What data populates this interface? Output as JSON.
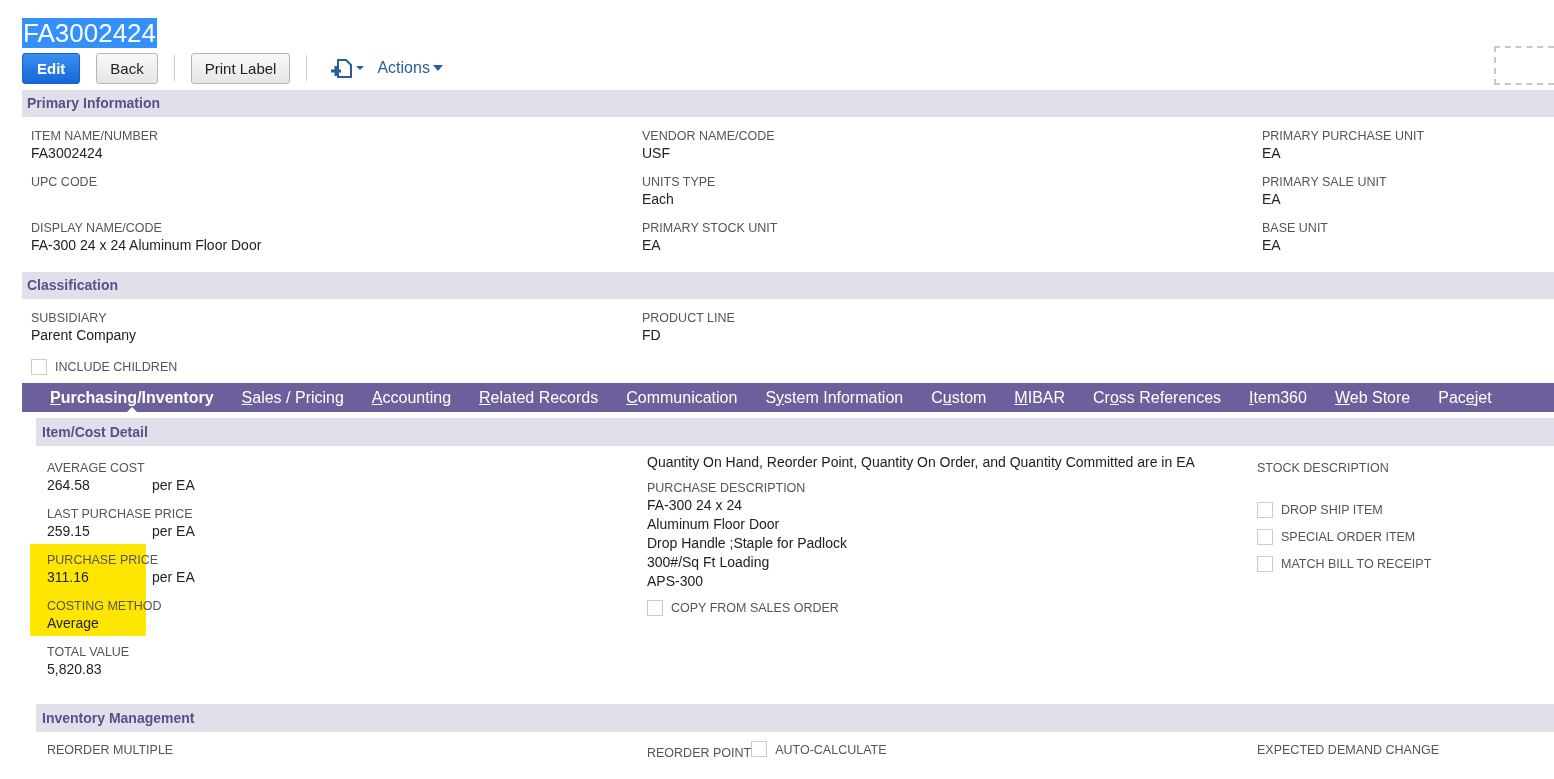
{
  "record": {
    "title": "FA3002424",
    "selected": true
  },
  "toolbar": {
    "buttons": [
      {
        "label": "Edit",
        "kind": "primary"
      },
      {
        "label": "Back",
        "kind": "default"
      },
      {
        "label": "Print Label",
        "kind": "default"
      }
    ],
    "actions": "Actions"
  },
  "primary_information": {
    "title": "Primary Information",
    "columns": [
      [
        {
          "label": "ITEM NAME/NUMBER",
          "value": "FA3002424"
        },
        {
          "label": "UPC CODE"
        },
        {
          "label": "DISPLAY NAME/CODE",
          "value": "FA-300 24 x 24 Aluminum Floor Door"
        }
      ],
      [
        {
          "label": "VENDOR NAME/CODE",
          "value": "USF"
        },
        {
          "label": "UNITS TYPE",
          "value": "Each"
        },
        {
          "label": "PRIMARY STOCK UNIT",
          "value": "EA"
        }
      ],
      [
        {
          "label": "PRIMARY PURCHASE UNIT",
          "value": "EA"
        },
        {
          "label": "PRIMARY SALE UNIT",
          "value": "EA"
        },
        {
          "label": "BASE UNIT",
          "value": "EA"
        }
      ]
    ]
  },
  "classification": {
    "title": "Classification",
    "subsidiary": {
      "label": "SUBSIDIARY",
      "value": "Parent Company"
    },
    "include_children": {
      "label": "INCLUDE CHILDREN",
      "checked": false
    },
    "product_line": {
      "label": "PRODUCT LINE",
      "value": "FD"
    }
  },
  "tabs": [
    {
      "key": "P",
      "after": "urchasing/Inventory",
      "selected": true
    },
    {
      "key": "S",
      "after": "ales / Pricing",
      "selected": false
    },
    {
      "key": "A",
      "after": "ccounting",
      "selected": false
    },
    {
      "key": "R",
      "after": "elated Records",
      "selected": false
    },
    {
      "key": "C",
      "after": "ommunication",
      "selected": false
    },
    {
      "before": "S",
      "key": "y",
      "after": "stem Information",
      "selected": false
    },
    {
      "before": "C",
      "key": "u",
      "after": "stom",
      "selected": false
    },
    {
      "key": "M",
      "after": "IBAR",
      "selected": false
    },
    {
      "before": "Cr",
      "key": "o",
      "after": "ss References",
      "selected": false
    },
    {
      "key": "I",
      "after": "tem360",
      "selected": false
    },
    {
      "key": "W",
      "after": "eb Store",
      "selected": false
    },
    {
      "before": "Pac",
      "key": "e",
      "after": "jet",
      "selected": false
    }
  ],
  "item_cost_detail": {
    "title": "Item/Cost Detail",
    "costs": [
      {
        "label": "AVERAGE COST",
        "value": "264.58",
        "unit": "per EA",
        "highlighted": false
      },
      {
        "label": "LAST PURCHASE PRICE",
        "value": "259.15",
        "unit": "per EA",
        "highlighted": false
      },
      {
        "label": "PURCHASE PRICE",
        "value": "311.16",
        "unit": "per EA",
        "highlighted": true
      },
      {
        "label": "COSTING METHOD",
        "value": "Average",
        "highlighted": true
      },
      {
        "label": "TOTAL VALUE",
        "value": "5,820.83",
        "highlighted": false
      }
    ],
    "note": "Quantity On Hand, Reorder Point, Quantity On Order, and Quantity Committed are in EA",
    "purchase_description": {
      "label": "PURCHASE DESCRIPTION",
      "lines": [
        "FA-300 24 x 24",
        "Aluminum Floor Door",
        "Drop Handle ;Staple for Padlock",
        "300#/Sq Ft Loading",
        "APS-300"
      ]
    },
    "copy_from_sales_order": {
      "label": "COPY FROM SALES ORDER",
      "checked": false
    },
    "stock_description": {
      "label": "STOCK DESCRIPTION"
    },
    "checkboxes": [
      {
        "label": "DROP SHIP ITEM",
        "checked": false
      },
      {
        "label": "SPECIAL ORDER ITEM",
        "checked": false
      },
      {
        "label": "MATCH BILL TO RECEIPT",
        "checked": false
      }
    ]
  },
  "inventory_management": {
    "title": "Inventory Management",
    "reorder_multiple": "REORDER MULTIPLE",
    "reorder_point": "REORDER POINT",
    "auto_calculate": {
      "label": "AUTO-CALCULATE",
      "checked": false
    },
    "expected_demand_change": "EXPECTED DEMAND CHANGE"
  }
}
